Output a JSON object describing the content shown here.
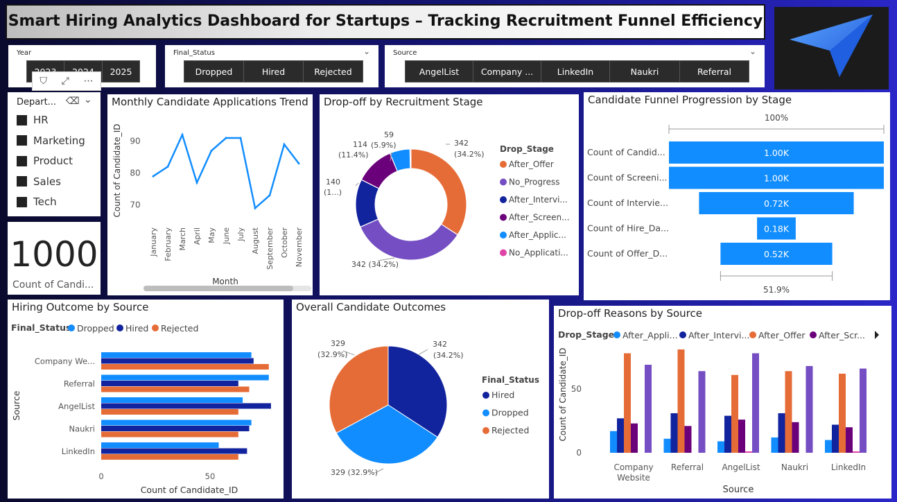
{
  "title": "Smart Hiring Analytics Dashboard for Startups – Tracking Recruitment Funnel Efficiency",
  "colors": {
    "dropped": "#118DFF",
    "hired": "#12239E",
    "rejected": "#E66C37",
    "purple": "#6B007B",
    "violet": "#744EC2",
    "pink": "#E044A7"
  },
  "year_slicer": {
    "title": "Year",
    "items": [
      "2023",
      "2024",
      "2025"
    ]
  },
  "status_slicer": {
    "title": "Final_Status",
    "items": [
      "Dropped",
      "Hired",
      "Rejected"
    ]
  },
  "source_slicer": {
    "title": "Source",
    "items": [
      "AngelList",
      "Company ...",
      "LinkedIn",
      "Naukri",
      "Referral"
    ]
  },
  "dept_slicer": {
    "title": "Depart...",
    "items": [
      "HR",
      "Marketing",
      "Product",
      "Sales",
      "Tech"
    ]
  },
  "kpi": {
    "value": "1000",
    "label": "Count of Candi..."
  },
  "charts": {
    "monthly": {
      "title": "Monthly Candidate Applications Trend",
      "xlabel": "Month",
      "ylabel": "Count of Candidate_ID",
      "yticks": [
        "90",
        "80",
        "70"
      ]
    },
    "dropoff": {
      "title": "Drop-off by Recruitment Stage",
      "legend_title": "Drop_Stage",
      "legend": [
        "After_Offer",
        "No_Progress",
        "After_Intervi...",
        "After_Screen...",
        "After_Applic...",
        "No_Applicati..."
      ],
      "labels": [
        {
          "v": "342",
          "p": "(34.2%)"
        },
        {
          "v": "342 (34.2%)",
          "p": ""
        },
        {
          "v": "140",
          "p": "(1...)"
        },
        {
          "v": "114",
          "p": "(11.4%)"
        },
        {
          "v": "59",
          "p": "(5.9%)"
        }
      ]
    },
    "funnel": {
      "title": "Candidate Funnel Progression by Stage",
      "top_pct": "100%",
      "bottom_pct": "51.9%",
      "rows": [
        {
          "label": "Count of Candid...",
          "value": "1.00K"
        },
        {
          "label": "Count of Screeni...",
          "value": "1.00K"
        },
        {
          "label": "Count of Intervie...",
          "value": "0.72K"
        },
        {
          "label": "Count of Hire_Da...",
          "value": "0.18K"
        },
        {
          "label": "Count of Offer_D...",
          "value": "0.52K"
        }
      ]
    },
    "hiring": {
      "title": "Hiring Outcome by Source",
      "legend_title": "Final_Status",
      "legend": [
        "Dropped",
        "Hired",
        "Rejected"
      ],
      "xlabel": "Count of Candidate_ID",
      "ylabel": "Source",
      "xticks": [
        "0",
        "50"
      ]
    },
    "outcomes": {
      "title": "Overall Candidate Outcomes",
      "legend_title": "Final_Status",
      "legend": [
        "Hired",
        "Dropped",
        "Rejected"
      ],
      "labels": [
        {
          "v": "342",
          "p": "(34.2%)"
        },
        {
          "v": "329 (32.9%)",
          "p": ""
        },
        {
          "v": "329",
          "p": "(32.9%)"
        }
      ]
    },
    "reasons": {
      "title": "Drop-off Reasons by Source",
      "legend_title": "Drop_Stage",
      "legend": [
        "After_Appli...",
        "After_Intervi...",
        "After_Offer",
        "After_Scr..."
      ],
      "xlabel": "Source",
      "ylabel": "Count of Candidate_ID",
      "yticks": [
        "50",
        "0"
      ]
    }
  },
  "chart_data": [
    {
      "type": "line",
      "title": "Monthly Candidate Applications Trend",
      "xlabel": "Month",
      "ylabel": "Count of Candidate_ID",
      "categories": [
        "January",
        "February",
        "March",
        "April",
        "May",
        "June",
        "July",
        "August",
        "September",
        "October",
        "November"
      ],
      "values": [
        79,
        82,
        92,
        77,
        87,
        91,
        91,
        69,
        73,
        89,
        83
      ],
      "ylim": [
        66,
        96
      ]
    },
    {
      "type": "pie",
      "title": "Drop-off by Recruitment Stage",
      "categories": [
        "After_Offer",
        "No_Progress",
        "After_Intervi...",
        "After_Screen...",
        "After_Applic...",
        "No_Applicati..."
      ],
      "values": [
        342,
        342,
        140,
        114,
        59,
        3
      ]
    },
    {
      "type": "bar",
      "title": "Candidate Funnel Progression by Stage",
      "categories": [
        "Count of Candid...",
        "Count of Screeni...",
        "Count of Intervie...",
        "Count of Hire_Da...",
        "Count of Offer_D..."
      ],
      "values": [
        1000,
        1000,
        720,
        180,
        520
      ]
    },
    {
      "type": "bar",
      "title": "Hiring Outcome by Source",
      "xlabel": "Count of Candidate_ID",
      "ylabel": "Source",
      "categories": [
        "Company We...",
        "Referral",
        "AngelList",
        "Naukri",
        "LinkedIn"
      ],
      "series": [
        {
          "name": "Dropped",
          "values": [
            69,
            77,
            65,
            69,
            54
          ]
        },
        {
          "name": "Hired",
          "values": [
            70,
            63,
            78,
            68,
            67
          ]
        },
        {
          "name": "Rejected",
          "values": [
            77,
            68,
            63,
            63,
            63
          ]
        }
      ],
      "xlim": [
        0,
        80
      ]
    },
    {
      "type": "pie",
      "title": "Overall Candidate Outcomes",
      "categories": [
        "Hired",
        "Dropped",
        "Rejected"
      ],
      "values": [
        342,
        329,
        329
      ]
    },
    {
      "type": "bar",
      "title": "Drop-off Reasons by Source",
      "xlabel": "Source",
      "ylabel": "Count of Candidate_ID",
      "categories": [
        "Company Website",
        "Referral",
        "AngelList",
        "Naukri",
        "LinkedIn"
      ],
      "series": [
        {
          "name": "After_Appli...",
          "values": [
            17,
            11,
            9,
            12,
            10
          ]
        },
        {
          "name": "After_Intervi...",
          "values": [
            27,
            31,
            29,
            31,
            22
          ]
        },
        {
          "name": "After_Offer",
          "values": [
            78,
            81,
            61,
            64,
            62
          ]
        },
        {
          "name": "After_Scr...",
          "values": [
            23,
            21,
            26,
            24,
            20
          ]
        },
        {
          "name": "No_Application",
          "values": [
            0,
            0,
            1,
            0,
            1
          ]
        },
        {
          "name": "No_Progress",
          "values": [
            69,
            64,
            78,
            68,
            66
          ]
        }
      ],
      "ylim": [
        0,
        85
      ]
    }
  ]
}
